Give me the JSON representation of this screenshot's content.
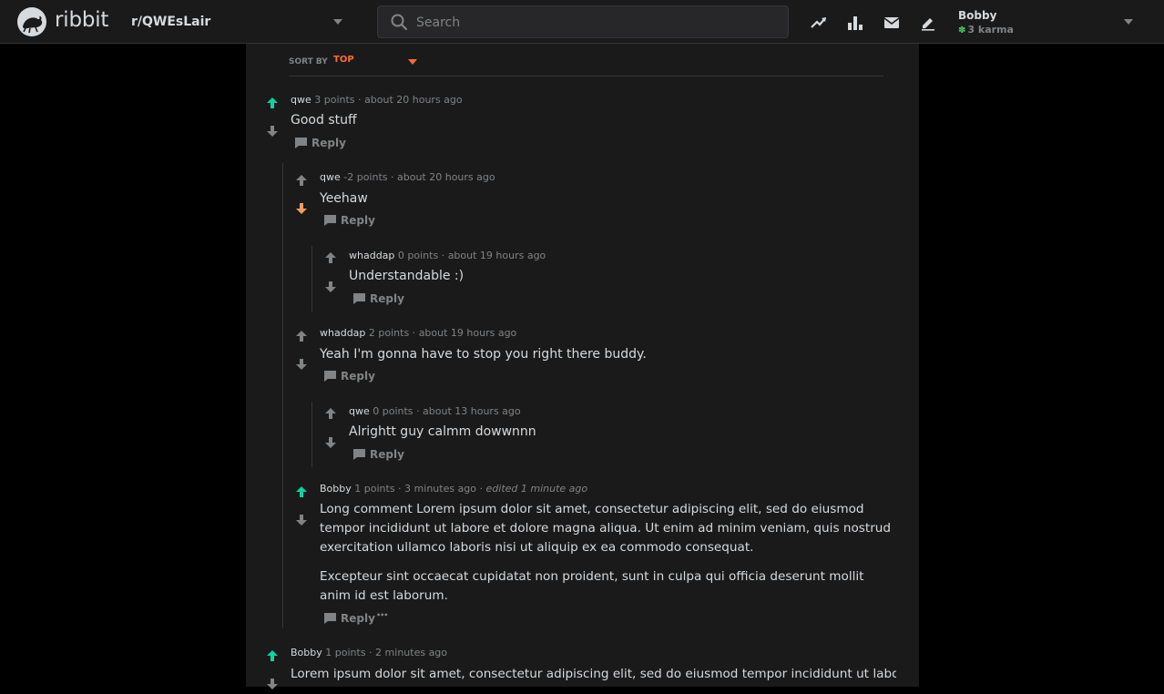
{
  "header": {
    "brand": "ribbit",
    "community": "r/QWEsLair",
    "search_placeholder": "Search",
    "icons": [
      "trending-icon",
      "leaderboard-icon",
      "mail-icon",
      "create-post-icon"
    ],
    "user": {
      "name": "Bobby",
      "karma": "3 karma"
    }
  },
  "sort": {
    "label": "SORT BY",
    "value": "TOP"
  },
  "comments": [
    {
      "author": "qwe",
      "points": "3 points",
      "time": "about 20 hours ago",
      "body": [
        "Good stuff"
      ],
      "reply": "Reply",
      "vote": "up"
    },
    {
      "author": "qwe",
      "points": "-2 points",
      "time": "about 20 hours ago",
      "body": [
        "Yeehaw"
      ],
      "reply": "Reply",
      "vote": "down"
    },
    {
      "author": "whaddap",
      "points": "0 points",
      "time": "about 19 hours ago",
      "body": [
        "Understandable :)"
      ],
      "reply": "Reply",
      "vote": "none"
    },
    {
      "author": "whaddap",
      "points": "2 points",
      "time": "about 19 hours ago",
      "body": [
        "Yeah I'm gonna have to stop you right there buddy."
      ],
      "reply": "Reply",
      "vote": "none"
    },
    {
      "author": "qwe",
      "points": "0 points",
      "time": "about 13 hours ago",
      "body": [
        "Alrightt guy calmm dowwnnn"
      ],
      "reply": "Reply",
      "vote": "none"
    },
    {
      "author": "Bobby",
      "points": "1 points",
      "time": "3 minutes ago",
      "edited": "edited 1 minute ago",
      "body": [
        "Long comment Lorem ipsum dolor sit amet, consectetur adipiscing elit, sed do eiusmod tempor incididunt ut labore et dolore magna aliqua. Ut enim ad minim veniam, quis nostrud exercitation ullamco laboris nisi ut aliquip ex ea commodo consequat.",
        "Excepteur sint occaecat cupidatat non proident, sunt in culpa qui officia deserunt mollit anim id est laborum."
      ],
      "reply": "Reply",
      "more": "•••",
      "vote": "up"
    },
    {
      "author": "Bobby",
      "points": "1 points",
      "time": "2 minutes ago",
      "body": [
        "Lorem ipsum dolor sit amet, consectetur adipiscing elit, sed do eiusmod tempor incididunt ut labore"
      ],
      "vote": "up"
    }
  ],
  "colors": {
    "upvote": "#0dd3a0",
    "downvote": "#f29b60",
    "neutral": "#818384",
    "sort_accent": "#ff6a33"
  }
}
